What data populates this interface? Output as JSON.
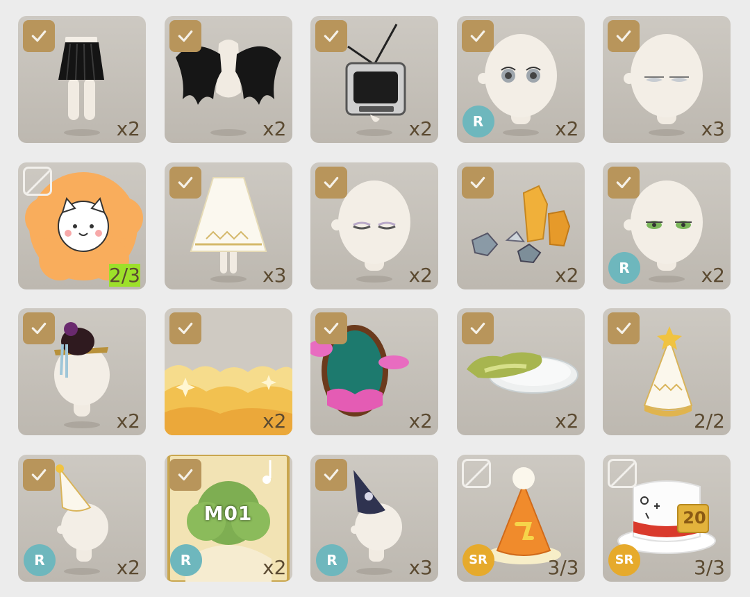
{
  "items": [
    {
      "name": "black-pleated-skirt",
      "status": "checked",
      "badge": "",
      "count": "x2"
    },
    {
      "name": "black-wings",
      "status": "checked",
      "badge": "",
      "count": "x2"
    },
    {
      "name": "retro-tv",
      "status": "checked",
      "badge": "",
      "count": "x2"
    },
    {
      "name": "big-eyes-face",
      "status": "checked",
      "badge": "R",
      "count": "x2"
    },
    {
      "name": "sleepy-face",
      "status": "checked",
      "badge": "",
      "count": "x3"
    },
    {
      "name": "cat-sun-sticker",
      "status": "locked",
      "badge": "",
      "count": "2/3"
    },
    {
      "name": "white-gold-cape",
      "status": "checked",
      "badge": "",
      "count": "x3"
    },
    {
      "name": "closed-eyes-face",
      "status": "checked",
      "badge": "",
      "count": "x2"
    },
    {
      "name": "gems-crystals",
      "status": "checked",
      "badge": "",
      "count": "x2"
    },
    {
      "name": "green-eyes-face",
      "status": "checked",
      "badge": "R",
      "count": "x2"
    },
    {
      "name": "dark-flower-hat",
      "status": "checked",
      "badge": "",
      "count": "x2"
    },
    {
      "name": "golden-cloud-background",
      "status": "checked",
      "badge": "",
      "count": "x2"
    },
    {
      "name": "moon-mirror",
      "status": "checked",
      "badge": "",
      "count": "x2"
    },
    {
      "name": "salad-plate",
      "status": "checked",
      "badge": "",
      "count": "x2"
    },
    {
      "name": "white-party-hat",
      "status": "checked",
      "badge": "",
      "count": "2/2"
    },
    {
      "name": "gold-party-hat-head",
      "status": "checked",
      "badge": "R",
      "count": "x2"
    },
    {
      "name": "m01-music-card",
      "status": "checked",
      "badge": "R",
      "count": "x2",
      "card_label": "M01"
    },
    {
      "name": "navy-wizard-hat",
      "status": "checked",
      "badge": "R",
      "count": "x3"
    },
    {
      "name": "orange-cake-hat",
      "status": "locked",
      "badge": "SR",
      "count": "3/3"
    },
    {
      "name": "white-top-hat",
      "status": "locked",
      "badge": "SR",
      "count": "3/3",
      "hat_label": "20"
    }
  ],
  "colors": {
    "tile": "#c5c1ba",
    "check": "#b8955b",
    "badge_r": "#6eb7bd",
    "badge_sr": "#e6aa2c",
    "count_text": "#5b4a31",
    "highlight": "#9de02a"
  },
  "icons": {
    "checked": "checkmark-icon",
    "locked": "slashed-square-icon"
  }
}
